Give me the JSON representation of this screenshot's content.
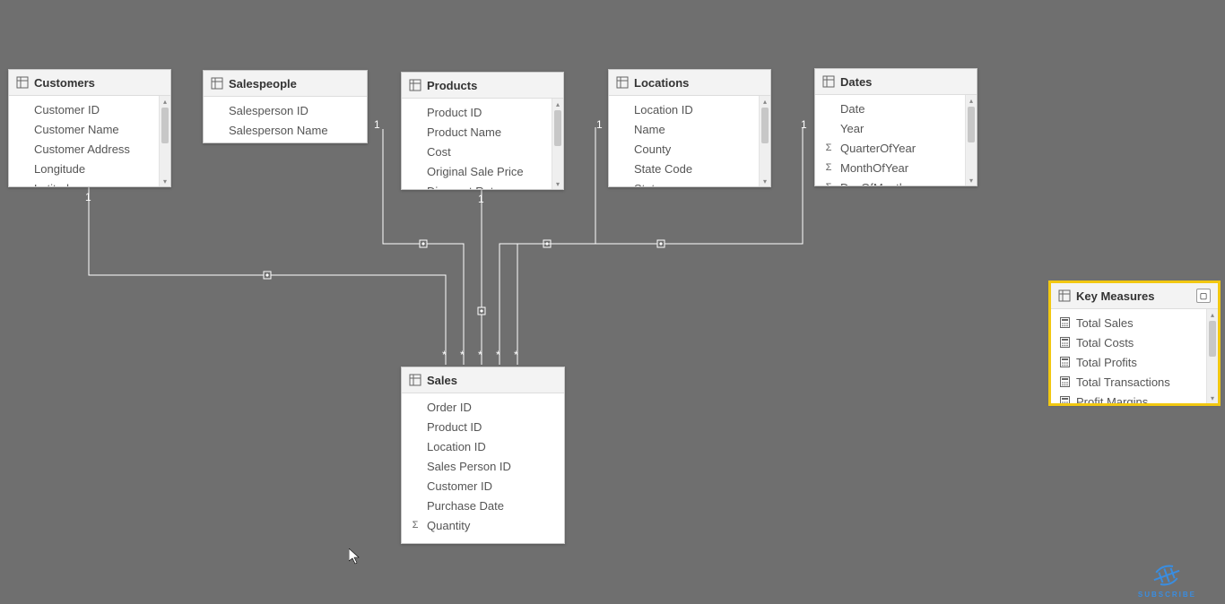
{
  "tables": {
    "customers": {
      "title": "Customers",
      "fields": [
        {
          "name": "Customer ID",
          "icon": ""
        },
        {
          "name": "Customer Name",
          "icon": ""
        },
        {
          "name": "Customer Address",
          "icon": ""
        },
        {
          "name": "Longitude",
          "icon": ""
        },
        {
          "name": "Latitude",
          "icon": ""
        }
      ]
    },
    "salespeople": {
      "title": "Salespeople",
      "fields": [
        {
          "name": "Salesperson ID",
          "icon": ""
        },
        {
          "name": "Salesperson Name",
          "icon": ""
        }
      ]
    },
    "products": {
      "title": "Products",
      "fields": [
        {
          "name": "Product ID",
          "icon": ""
        },
        {
          "name": "Product Name",
          "icon": ""
        },
        {
          "name": "Cost",
          "icon": ""
        },
        {
          "name": "Original Sale Price",
          "icon": ""
        },
        {
          "name": "Discount Rate",
          "icon": ""
        }
      ]
    },
    "locations": {
      "title": "Locations",
      "fields": [
        {
          "name": "Location ID",
          "icon": ""
        },
        {
          "name": "Name",
          "icon": ""
        },
        {
          "name": "County",
          "icon": ""
        },
        {
          "name": "State Code",
          "icon": ""
        },
        {
          "name": "State",
          "icon": ""
        }
      ]
    },
    "dates": {
      "title": "Dates",
      "fields": [
        {
          "name": "Date",
          "icon": ""
        },
        {
          "name": "Year",
          "icon": ""
        },
        {
          "name": "QuarterOfYear",
          "icon": "Σ"
        },
        {
          "name": "MonthOfYear",
          "icon": "Σ"
        },
        {
          "name": "DayOfMonth",
          "icon": "Σ"
        }
      ]
    },
    "sales": {
      "title": "Sales",
      "fields": [
        {
          "name": "Order ID",
          "icon": ""
        },
        {
          "name": "Product ID",
          "icon": ""
        },
        {
          "name": "Location ID",
          "icon": ""
        },
        {
          "name": "Sales Person ID",
          "icon": ""
        },
        {
          "name": "Customer ID",
          "icon": ""
        },
        {
          "name": "Purchase Date",
          "icon": ""
        },
        {
          "name": "Quantity",
          "icon": "Σ"
        }
      ]
    },
    "key_measures": {
      "title": "Key Measures",
      "fields": [
        {
          "name": "Total Sales",
          "icon": "calc"
        },
        {
          "name": "Total Costs",
          "icon": "calc"
        },
        {
          "name": "Total Profits",
          "icon": "calc"
        },
        {
          "name": "Total Transactions",
          "icon": "calc"
        },
        {
          "name": "Profit Margins",
          "icon": "calc"
        }
      ]
    }
  },
  "cardinality_labels": {
    "one": "1",
    "many": "*"
  },
  "relationships": [
    {
      "from": "customers",
      "to": "sales",
      "from_card": "1",
      "to_card": "*"
    },
    {
      "from": "salespeople",
      "to": "sales",
      "from_card": "1",
      "to_card": "*"
    },
    {
      "from": "products",
      "to": "sales",
      "from_card": "1",
      "to_card": "*"
    },
    {
      "from": "locations",
      "to": "sales",
      "from_card": "1",
      "to_card": "*"
    },
    {
      "from": "dates",
      "to": "sales",
      "from_card": "1",
      "to_card": "*"
    }
  ],
  "subscribe_label": "SUBSCRIBE"
}
